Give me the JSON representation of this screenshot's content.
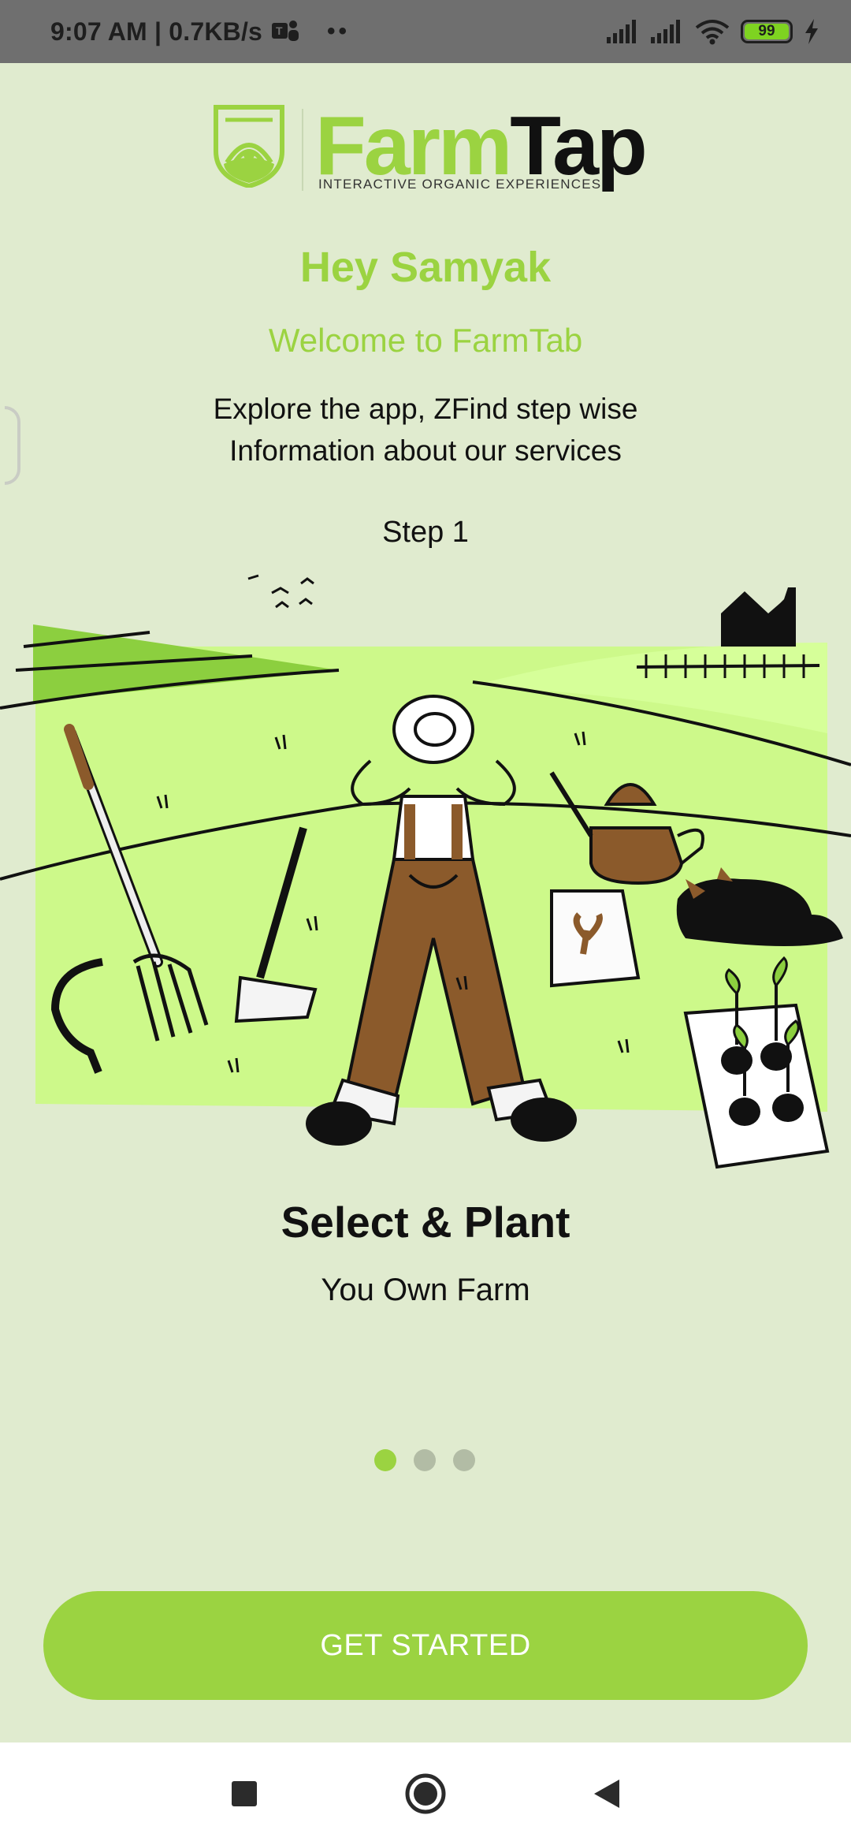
{
  "status_bar": {
    "time_speed": "9:07 AM | 0.7KB/s",
    "dots": "••",
    "battery": "99"
  },
  "logo": {
    "word_farm": "Farm",
    "word_tap": "Tap",
    "tagline": "INTERACTIVE ORGANIC EXPERIENCES"
  },
  "greeting": "Hey Samyak",
  "welcome": "Welcome to FarmTab",
  "explore_line1": "Explore the app, ZFind step wise",
  "explore_line2": "Information about our services",
  "step": "Step 1",
  "slide": {
    "title": "Select & Plant",
    "subtitle": "You Own Farm",
    "page_count": 3,
    "active_page": 1
  },
  "cta_label": "GET STARTED",
  "colors": {
    "accent": "#9bd341",
    "background": "#e0ebcf",
    "status_bar": "#6f6f6f"
  },
  "icons": {
    "nav_recents": "square-icon",
    "nav_home": "circle-icon",
    "nav_back": "triangle-back-icon"
  }
}
